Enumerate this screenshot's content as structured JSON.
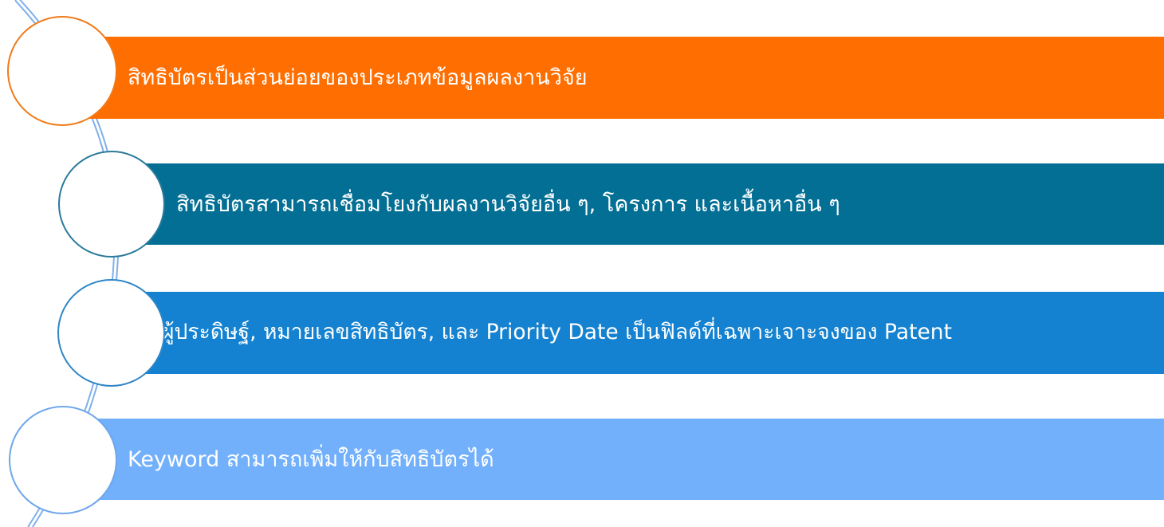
{
  "colors": {
    "spine": "#7fb0ea",
    "spine_core": "#ffffff"
  },
  "items": [
    {
      "text": "สิทธิบัตรเป็นส่วนย่อยของประเภทข้อมูลผลงานวิจัย",
      "fill": "#ff6e00",
      "ring": "#f07a18"
    },
    {
      "text": "สิทธิบัตรสามารถเชื่อมโยงกับผลงานวิจัยอื่น ๆ, โครงการ และเนื้อหาอื่น ๆ",
      "fill": "#036f94",
      "ring": "#2a7a9a"
    },
    {
      "text": "ผู้ประดิษฐ์, หมายเลขสิทธิบัตร, และ Priority Date เป็นฟิลด์ที่เฉพาะเจาะจงของ Patent",
      "fill": "#1482d0",
      "ring": "#2f86c6"
    },
    {
      "text": "Keyword สามารถเพิ่มให้กับสิทธิบัตรได้",
      "fill": "#72b0fc",
      "ring": "#6ea6ea"
    }
  ]
}
